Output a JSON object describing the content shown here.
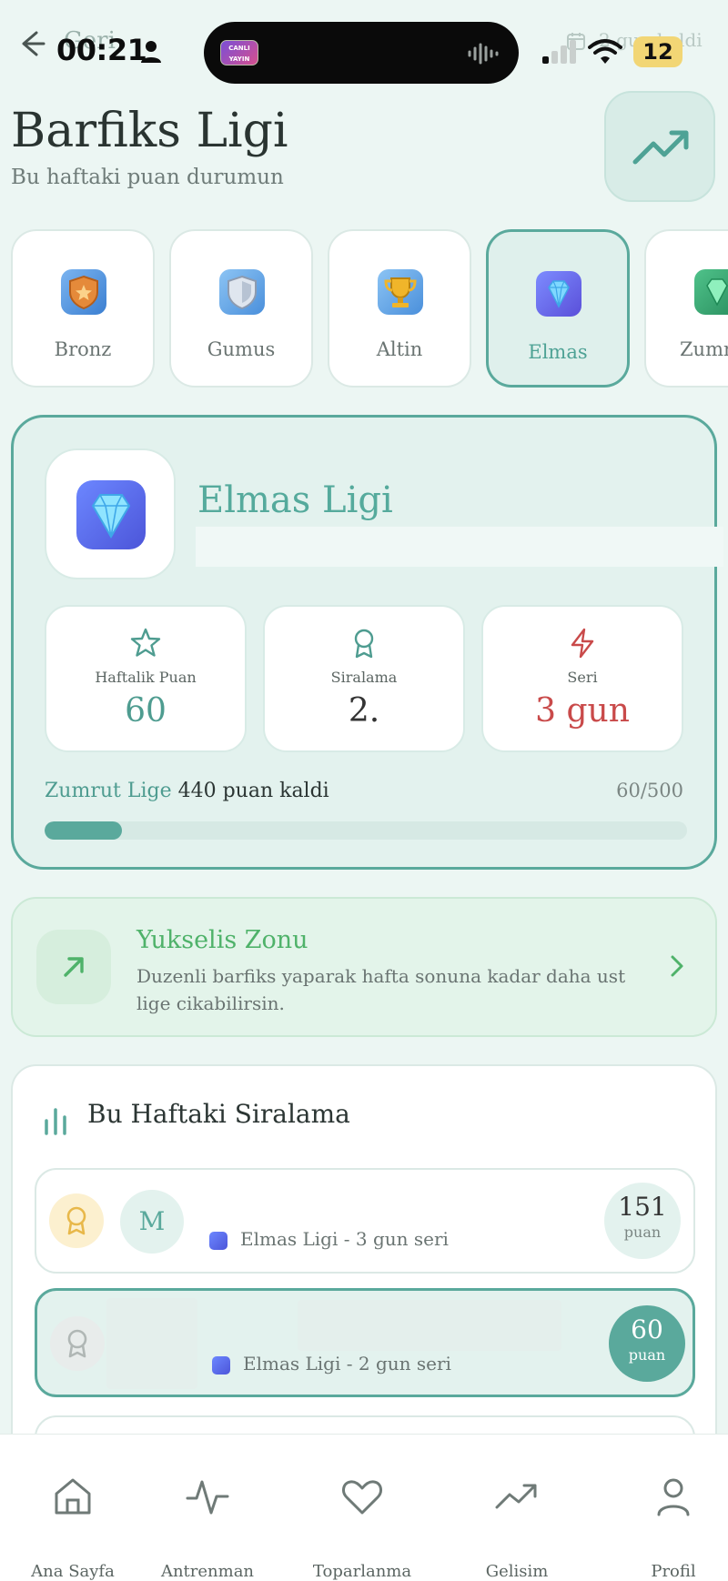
{
  "status_bar": {
    "time": "00:21",
    "battery": "12",
    "back_label": "Geri",
    "days_left": "2 gun kaldi",
    "island_app_label": "CANLI YAYIN"
  },
  "header": {
    "title": "Barfiks Ligi",
    "subtitle": "Bu haftaki puan durumun"
  },
  "tabs": [
    {
      "label": "Bronz",
      "icon": "bronze-shield-icon",
      "color": "#e58a3a"
    },
    {
      "label": "Gumus",
      "icon": "silver-shield-icon",
      "color": "#9fb0c8"
    },
    {
      "label": "Altin",
      "icon": "gold-trophy-icon",
      "color": "#f0b52a"
    },
    {
      "label": "Elmas",
      "icon": "diamond-icon",
      "color": "#6c6ee8",
      "active": true
    },
    {
      "label": "Zumrut",
      "icon": "emerald-icon",
      "color": "#2fa46e"
    }
  ],
  "league": {
    "name": "Elmas Ligi",
    "stats": [
      {
        "label": "Haftalik Puan",
        "value": "60",
        "icon": "star-icon",
        "color": "#4e9c90"
      },
      {
        "label": "Siralama",
        "value": "2.",
        "icon": "award-icon",
        "color": "#333333"
      },
      {
        "label": "Seri",
        "value": "3 gun",
        "icon": "lightning-icon",
        "color": "#c94a4a"
      }
    ],
    "progress": {
      "next_league": "Zumrut Lige",
      "remaining_text": "440 puan kaldi",
      "count_text": "60/500",
      "fraction": 0.12
    }
  },
  "promotion": {
    "title": "Yukselis Zonu",
    "description": "Duzenli barfiks yaparak hafta sonuna kadar daha ust lige cikabilirsin."
  },
  "ranking": {
    "title": "Bu Haftaki Siralama",
    "rows": [
      {
        "avatar": "M",
        "meta_league": "Elmas Ligi",
        "meta_sep": "-",
        "meta_streak": "3 gun seri",
        "score": "151",
        "unit": "puan",
        "medal_color": "#e8b84a",
        "medal_bg": "#fcf0cf"
      },
      {
        "avatar": "",
        "meta_league": "Elmas Ligi",
        "meta_sep": "-",
        "meta_streak": "2 gun seri",
        "score": "60",
        "unit": "puan",
        "medal_color": "#b0b7b5",
        "medal_bg": "#e8eceb"
      }
    ]
  },
  "nav": [
    {
      "label": "Ana Sayfa",
      "icon": "home-icon"
    },
    {
      "label": "Antrenman",
      "icon": "activity-icon"
    },
    {
      "label": "Toparlanma",
      "icon": "heart-icon"
    },
    {
      "label": "Gelisim",
      "icon": "trending-up-icon"
    },
    {
      "label": "Profil",
      "icon": "user-icon"
    }
  ]
}
